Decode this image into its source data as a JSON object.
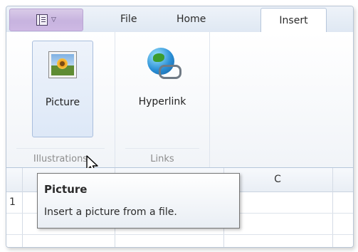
{
  "tabs": {
    "file": "File",
    "home": "Home",
    "insert": "Insert"
  },
  "ribbon": {
    "groups": [
      {
        "caption": "Illustrations",
        "buttons": [
          {
            "label": "Picture",
            "icon": "picture-icon"
          }
        ]
      },
      {
        "caption": "Links",
        "buttons": [
          {
            "label": "Hyperlink",
            "icon": "hyperlink-icon"
          }
        ]
      }
    ]
  },
  "sheet": {
    "column_headers": [
      "C"
    ],
    "row_numbers": [
      "1"
    ]
  },
  "tooltip": {
    "title": "Picture",
    "description": "Insert a picture from a file."
  },
  "colors": {
    "app_button": "#c7b3df",
    "ribbon_border": "#b6c6db",
    "selected_button": "#dde8f7"
  }
}
